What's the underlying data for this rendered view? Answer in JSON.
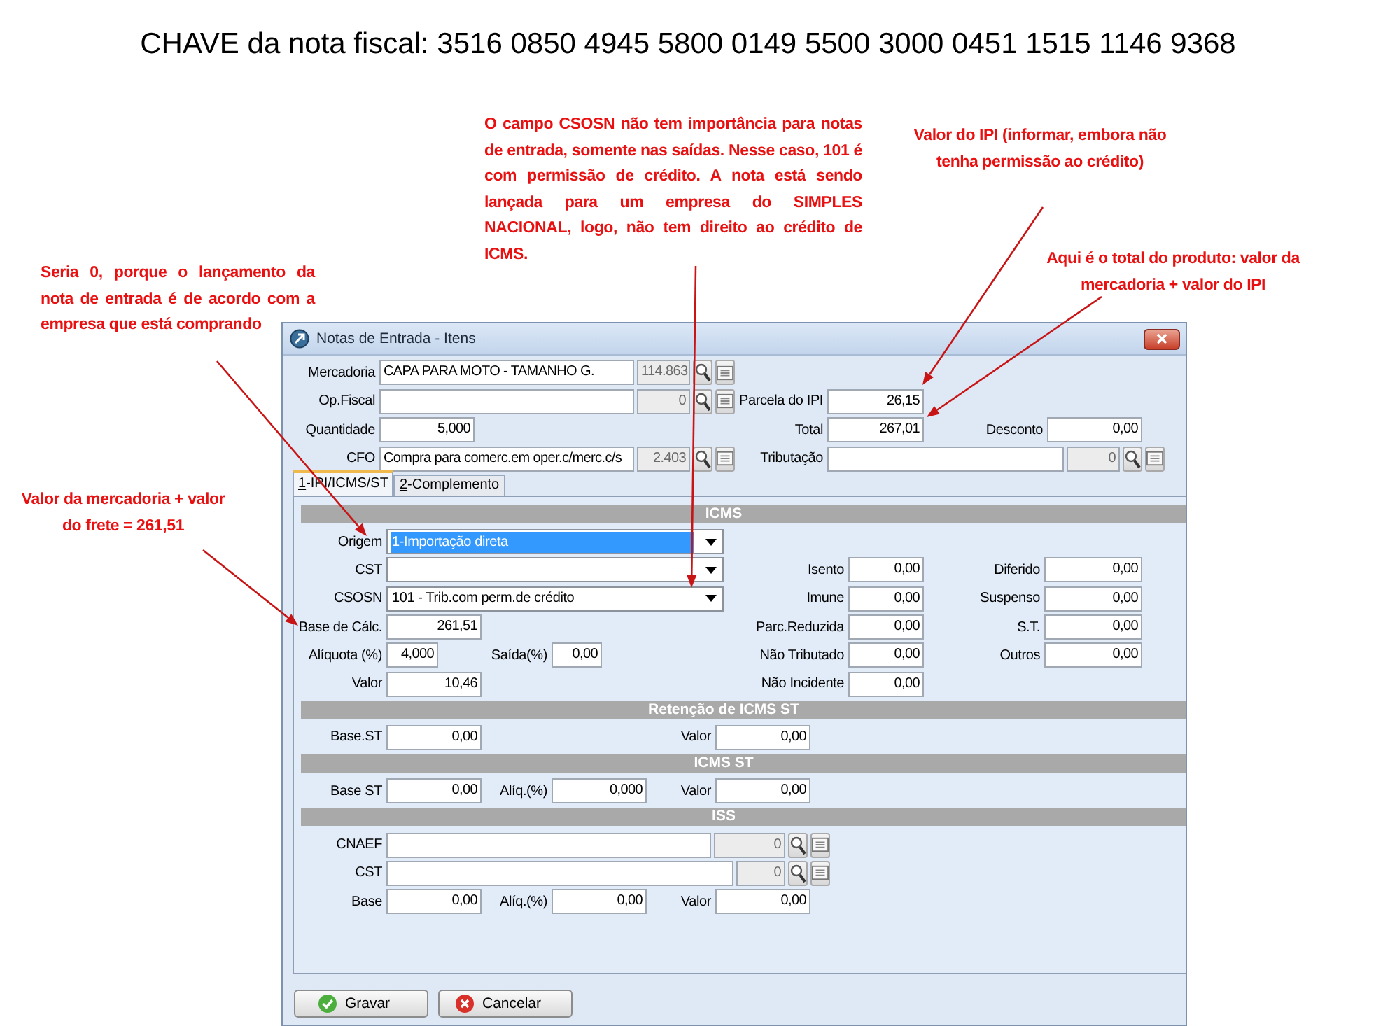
{
  "title": "CHAVE da nota fiscal: 3516 0850 4945 5800 0149 5500 3000 0451 1515 1146 9368",
  "annotations": [
    {
      "text": "O campo CSOSN não tem importância para notas de entrada, somente nas saídas. Nesse caso, 101 é com permissão de crédito. A nota está sendo lançada para um empresa do SIMPLES NACIONAL, logo, não tem direito ao crédito de ICMS."
    },
    {
      "text": "Valor do IPI (informar, embora não tenha permissão ao crédito)"
    },
    {
      "text": "Aqui é o total do produto: valor da mercadoria + valor do IPI"
    },
    {
      "text": "Seria 0, porque o lançamento da nota de entrada é de acordo com a empresa que está comprando"
    },
    {
      "text": "Valor da mercadoria + valor do frete = 261,51"
    }
  ],
  "window": {
    "title": "Notas de Entrada - Itens",
    "header": {
      "fields": [
        {
          "label": "Mercadoria",
          "kind": "lookup",
          "value": "CAPA PARA MOTO - TAMANHO G.",
          "code": "114.863"
        },
        {
          "label": "Op.Fiscal",
          "kind": "lookup",
          "code": "0"
        },
        {
          "label": "Parcela do IPI",
          "kind": "number",
          "value": "26,15"
        },
        {
          "label": "Quantidade",
          "kind": "number",
          "value": "5,000"
        },
        {
          "label": "Total",
          "kind": "number",
          "value": "267,01"
        },
        {
          "label": "Desconto",
          "kind": "number",
          "value": "0,00"
        },
        {
          "label": "CFO",
          "kind": "lookup",
          "value": "Compra para comerc.em oper.c/merc.c/s",
          "code": "2.403"
        },
        {
          "label": "Tributação",
          "kind": "lookup",
          "code": "0"
        }
      ]
    },
    "tabs": [
      {
        "label": "1-IPI/ICMS/ST",
        "selected": true
      },
      {
        "label": "2-Complemento",
        "selected": false
      }
    ],
    "sections": [
      {
        "title": "ICMS",
        "fields": [
          {
            "label": "Origem",
            "kind": "combo",
            "value": "1-Importação direta",
            "highlighted": true
          },
          {
            "label": "CST",
            "kind": "combo",
            "highlighted": false
          },
          {
            "label": "Isento",
            "kind": "number",
            "value": "0,00"
          },
          {
            "label": "Diferido",
            "kind": "number",
            "value": "0,00"
          },
          {
            "label": "CSOSN",
            "kind": "combo",
            "value": "101 - Trib.com perm.de crédito",
            "highlighted": false
          },
          {
            "label": "Imune",
            "kind": "number",
            "value": "0,00"
          },
          {
            "label": "Suspenso",
            "kind": "number",
            "value": "0,00"
          },
          {
            "label": "Base de Cálc.",
            "kind": "number",
            "value": "261,51"
          },
          {
            "label": "Parc.Reduzida",
            "kind": "number",
            "value": "0,00"
          },
          {
            "label": "S.T.",
            "kind": "number",
            "value": "0,00"
          },
          {
            "label": "Alíquota (%)",
            "kind": "number",
            "value": "4,000"
          },
          {
            "label": "Saída(%)",
            "kind": "number",
            "value": "0,00"
          },
          {
            "label": "Não Tributado",
            "kind": "number",
            "value": "0,00"
          },
          {
            "label": "Outros",
            "kind": "number",
            "value": "0,00"
          },
          {
            "label": "Valor",
            "kind": "number",
            "value": "10,46"
          },
          {
            "label": "Não Incidente",
            "kind": "number",
            "value": "0,00"
          }
        ]
      },
      {
        "title": "Retenção de ICMS ST",
        "fields": [
          {
            "label": "Base.ST",
            "kind": "number",
            "value": "0,00"
          },
          {
            "label": "Valor",
            "kind": "number",
            "value": "0,00"
          }
        ]
      },
      {
        "title": "ICMS ST",
        "fields": [
          {
            "label": "Base ST",
            "kind": "number",
            "value": "0,00"
          },
          {
            "label": "Alíq.(%)",
            "kind": "number",
            "value": "0,000"
          },
          {
            "label": "Valor",
            "kind": "number",
            "value": "0,00"
          }
        ]
      },
      {
        "title": "ISS",
        "fields": [
          {
            "label": "CNAEF",
            "kind": "lookup",
            "code": "0"
          },
          {
            "label": "CST",
            "kind": "lookup",
            "code": "0"
          },
          {
            "label": "Base",
            "kind": "number",
            "value": "0,00"
          },
          {
            "label": "Alíq.(%)",
            "kind": "number",
            "value": "0,00"
          },
          {
            "label": "Valor",
            "kind": "number",
            "value": "0,00"
          }
        ]
      }
    ],
    "buttons": [
      {
        "label": "Gravar",
        "kind": "confirm"
      },
      {
        "label": "Cancelar",
        "kind": "cancel"
      }
    ]
  }
}
